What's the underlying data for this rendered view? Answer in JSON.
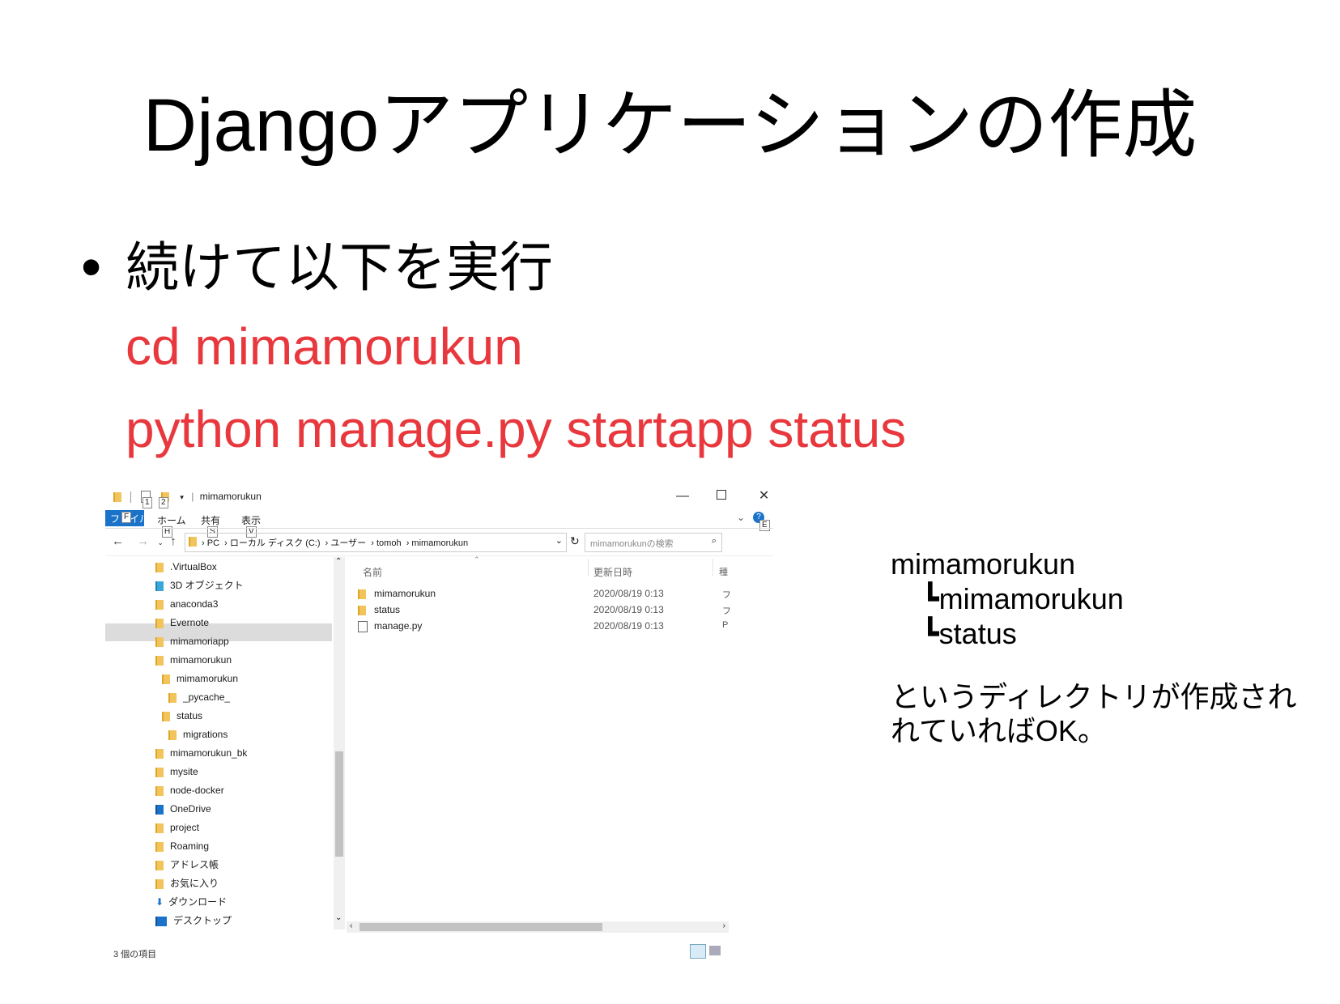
{
  "slide": {
    "title": "Djangoアプリケーションの作成",
    "bullet_marker": "•",
    "bullet_text": "続けて以下を実行",
    "commands": [
      "cd mimamorukun",
      "python manage.py startapp status"
    ],
    "command_color": "#e8383d"
  },
  "explorer": {
    "title": "mimamorukun",
    "qat_badges": [
      "1",
      "2"
    ],
    "ribbon_tabs": [
      {
        "label": "ファイル",
        "badge": "F"
      },
      {
        "label": "ホーム",
        "badge": "H"
      },
      {
        "label": "共有",
        "badge": "S"
      },
      {
        "label": "表示",
        "badge": "V"
      }
    ],
    "help_badge": "E",
    "breadcrumb": [
      "PC",
      "ローカル ディスク (C:)",
      "ユーザー",
      "tomoh",
      "mimamorukun"
    ],
    "search_placeholder": "mimamorukunの検索",
    "tree": [
      {
        "label": ".VirtualBox",
        "level": 0
      },
      {
        "label": "3D オブジェクト",
        "level": 0
      },
      {
        "label": "anaconda3",
        "level": 0
      },
      {
        "label": "Evernote",
        "level": 0
      },
      {
        "label": "mimamoriapp",
        "level": 0
      },
      {
        "label": "mimamorukun",
        "level": 0,
        "selected": true
      },
      {
        "label": "mimamorukun",
        "level": 1
      },
      {
        "label": "_pycache_",
        "level": 2
      },
      {
        "label": "status",
        "level": 1
      },
      {
        "label": "migrations",
        "level": 2
      },
      {
        "label": "mimamorukun_bk",
        "level": 0
      },
      {
        "label": "mysite",
        "level": 0
      },
      {
        "label": "node-docker",
        "level": 0
      },
      {
        "label": "OneDrive",
        "level": 0
      },
      {
        "label": "project",
        "level": 0
      },
      {
        "label": "Roaming",
        "level": 0
      },
      {
        "label": "アドレス帳",
        "level": 0
      },
      {
        "label": "お気に入り",
        "level": 0
      },
      {
        "label": "ダウンロード",
        "level": 0
      },
      {
        "label": "デスクトップ",
        "level": 0
      }
    ],
    "columns": {
      "name": "名前",
      "date": "更新日時",
      "type": "種"
    },
    "files": [
      {
        "name": "mimamorukun",
        "date": "2020/08/19 0:13",
        "type": "フ",
        "kind": "folder"
      },
      {
        "name": "status",
        "date": "2020/08/19 0:13",
        "type": "フ",
        "kind": "folder"
      },
      {
        "name": "manage.py",
        "date": "2020/08/19 0:13",
        "type": "P",
        "kind": "file"
      }
    ],
    "status_text": "3 個の項目"
  },
  "explanation": {
    "tree_lines": [
      "mimamorukun",
      "┗mimamorukun",
      "┗status"
    ],
    "note_lines": [
      "というディレクトリが作成され",
      "れていればOK。"
    ]
  }
}
